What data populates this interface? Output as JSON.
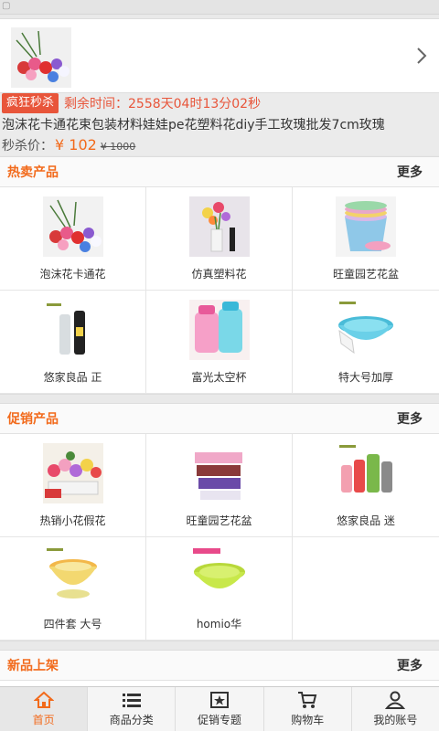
{
  "header": {
    "corner_glyph": "▢"
  },
  "flash_sale": {
    "tag": "疯狂秒杀",
    "timer": "剩余时间：2558天04时13分02秒",
    "title": "泡沫花卡通花束包装材料娃娃pe花塑料花diy手工玫瑰批发7cm玫瑰",
    "price_label": "秒杀价：",
    "price": "¥ 102",
    "original_price": "¥ 1000"
  },
  "hot": {
    "title": "热卖产品",
    "more": "更多",
    "items": [
      {
        "name": "泡沫花卡通花",
        "icon": "flower-bouquet"
      },
      {
        "name": "仿真塑料花",
        "icon": "vase-flowers"
      },
      {
        "name": "旺童园艺花盆",
        "icon": "stacked-pots"
      },
      {
        "name": "悠家良品 正",
        "icon": "thermos-bottles"
      },
      {
        "name": "富光太空杯",
        "icon": "space-cups"
      },
      {
        "name": "特大号加厚",
        "icon": "blue-basin"
      }
    ]
  },
  "promo": {
    "title": "促销产品",
    "more": "更多",
    "items": [
      {
        "name": "热销小花假花",
        "icon": "flower-planter"
      },
      {
        "name": "旺童园艺花盆",
        "icon": "planter-boxes"
      },
      {
        "name": "悠家良品 迷",
        "icon": "color-cups"
      },
      {
        "name": "四件套 大号",
        "icon": "yellow-basins"
      },
      {
        "name": "homio华",
        "icon": "green-basin"
      }
    ]
  },
  "new": {
    "title": "新品上架",
    "more": "更多"
  },
  "tabs": [
    {
      "label": "首页",
      "icon": "home-icon",
      "active": true
    },
    {
      "label": "商品分类",
      "icon": "list-icon"
    },
    {
      "label": "促销专题",
      "icon": "star-icon"
    },
    {
      "label": "购物车",
      "icon": "cart-icon"
    },
    {
      "label": "我的账号",
      "icon": "user-icon"
    }
  ],
  "colors": {
    "accent": "#f26a1b",
    "tag": "#e8553a"
  }
}
